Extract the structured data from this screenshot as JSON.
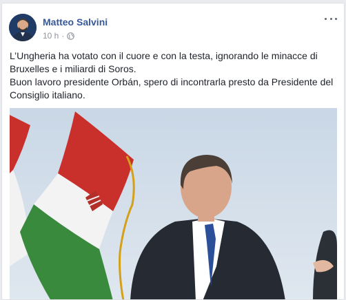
{
  "post": {
    "author": "Matteo Salvini",
    "time": "10 h",
    "separator": "·",
    "text_lines": [
      "L’Ungheria ha votato con il cuore e con la testa, ignorando le minacce di",
      "Bruxelles e i miliardi di Soros.",
      "Buon lavoro presidente Orbán, spero di incontrarla presto da Presidente del",
      "Consiglio italiano."
    ]
  },
  "icons": {
    "globe": "globe-icon",
    "more": "more-options-icon"
  },
  "colors": {
    "author_link": "#365899",
    "meta_text": "#90949c",
    "body_text": "#1d2129",
    "page_background": "#e9ebee"
  }
}
